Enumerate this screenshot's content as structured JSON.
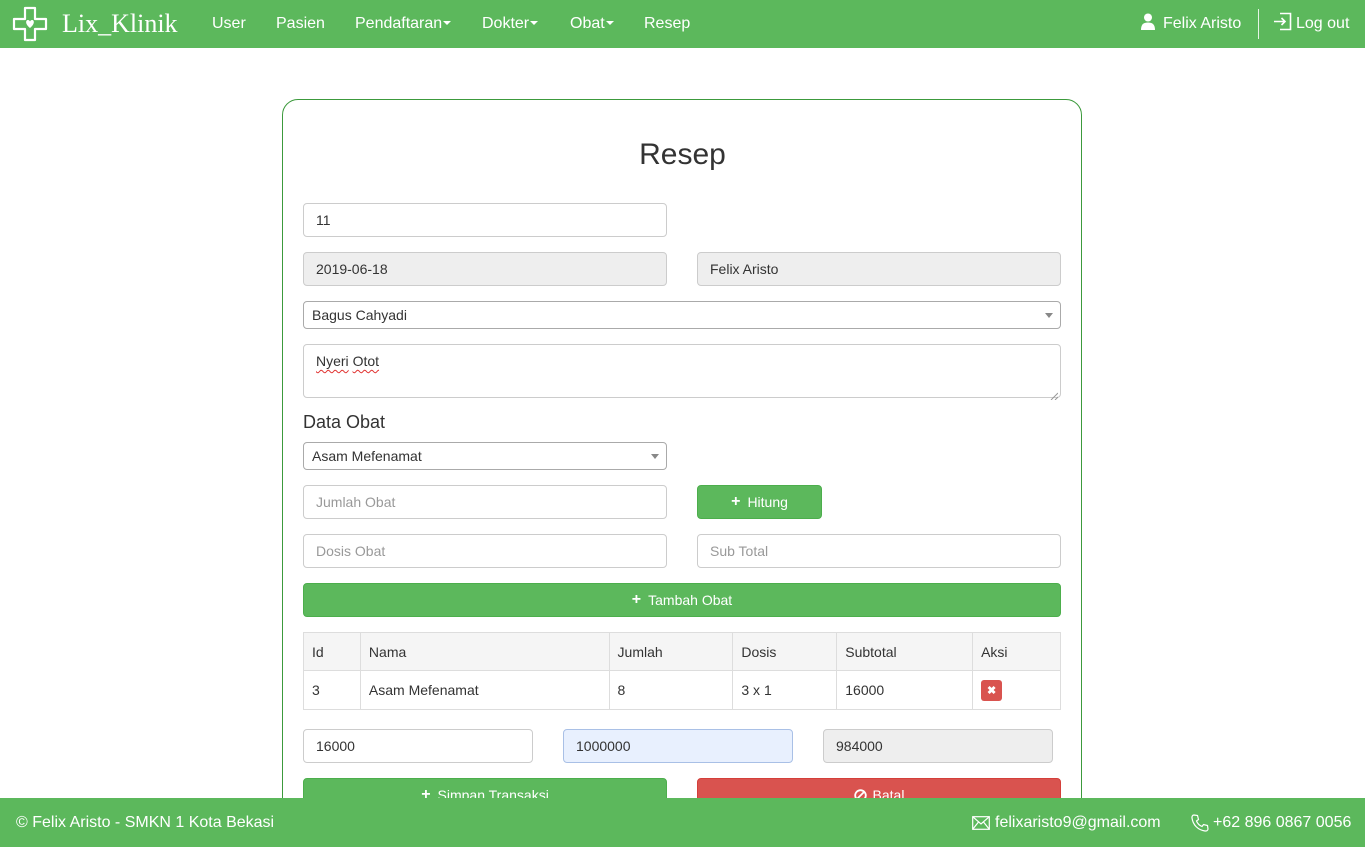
{
  "navbar": {
    "brand": "Lix_Klinik",
    "brand_icon": "medical-cross-heart-icon",
    "menu": {
      "user": "User",
      "pasien": "Pasien",
      "pendaftaran": "Pendaftaran",
      "dokter": "Dokter",
      "obat": "Obat",
      "resep": "Resep"
    },
    "account_name": "Felix Aristo",
    "logout": "Log out"
  },
  "form": {
    "title": "Resep",
    "id_value": "11",
    "date_value": "2019-06-18",
    "user_value": "Felix Aristo",
    "pasien_selected": "Bagus Cahyadi",
    "keluhan_word1": "Nyeri",
    "keluhan_word2": "Otot",
    "data_obat_title": "Data Obat",
    "obat_selected": "Asam Mefenamat",
    "jumlah_placeholder": "Jumlah Obat",
    "dosis_placeholder": "Dosis Obat",
    "subtotal_placeholder": "Sub Total",
    "hitung_label": "Hitung",
    "tambah_label": "Tambah Obat",
    "total_value": "16000",
    "bayar_value": "1000000",
    "kembali_value": "984000",
    "simpan_label": "Simpan Transaksi",
    "batal_label": "Batal"
  },
  "table": {
    "headers": [
      "Id",
      "Nama",
      "Jumlah",
      "Dosis",
      "Subtotal",
      "Aksi"
    ],
    "rows": [
      [
        "3",
        "Asam Mefenamat",
        "8",
        "3 x 1",
        "16000"
      ]
    ]
  },
  "footer": {
    "copyright": "© Felix Aristo - SMKN 1 Kota Bekasi",
    "email": "felixaristo9@gmail.com",
    "phone": "+62 896 0867 0056"
  },
  "colors": {
    "primary_green": "#5cb85c",
    "danger_red": "#d9534f",
    "card_border": "#3c9a3c"
  }
}
